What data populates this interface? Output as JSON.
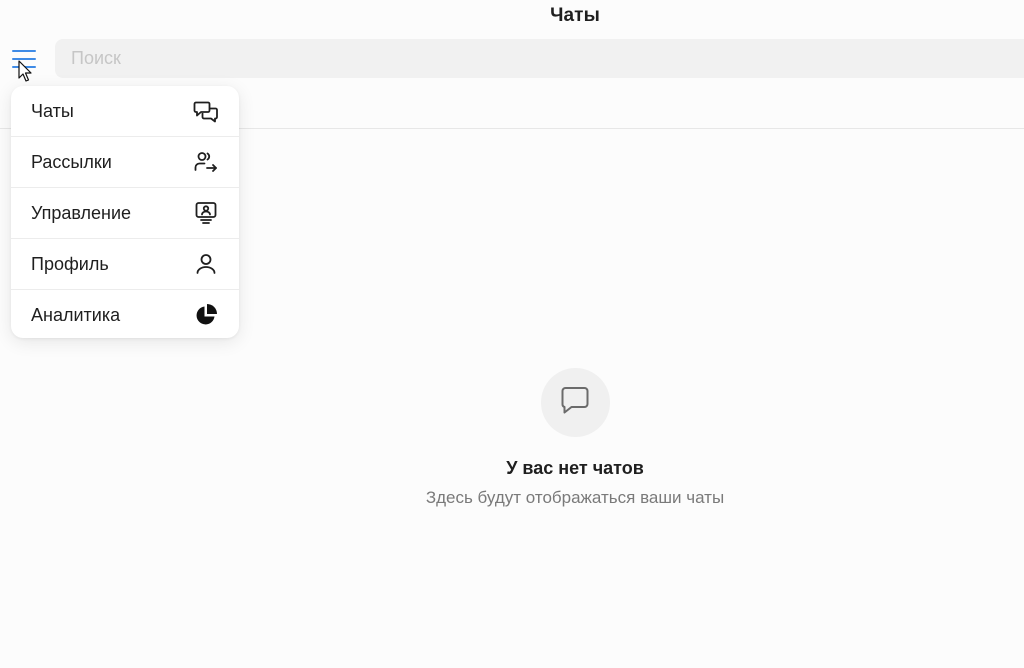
{
  "header": {
    "title": "Чаты"
  },
  "search": {
    "placeholder": "Поиск"
  },
  "menu": {
    "items": [
      {
        "label": "Чаты",
        "icon": "chats-icon"
      },
      {
        "label": "Рассылки",
        "icon": "mailing-users-icon"
      },
      {
        "label": "Управление",
        "icon": "management-monitor-icon"
      },
      {
        "label": "Профиль",
        "icon": "profile-user-icon"
      },
      {
        "label": "Аналитика",
        "icon": "analytics-pie-icon"
      }
    ]
  },
  "empty_state": {
    "icon": "chat-bubble-icon",
    "title": "У вас нет чатов",
    "subtitle": "Здесь будут отображаться ваши чаты"
  },
  "colors": {
    "accent": "#3f8be6",
    "background": "#fcfcfc",
    "search_bg": "#f1f1f1"
  }
}
